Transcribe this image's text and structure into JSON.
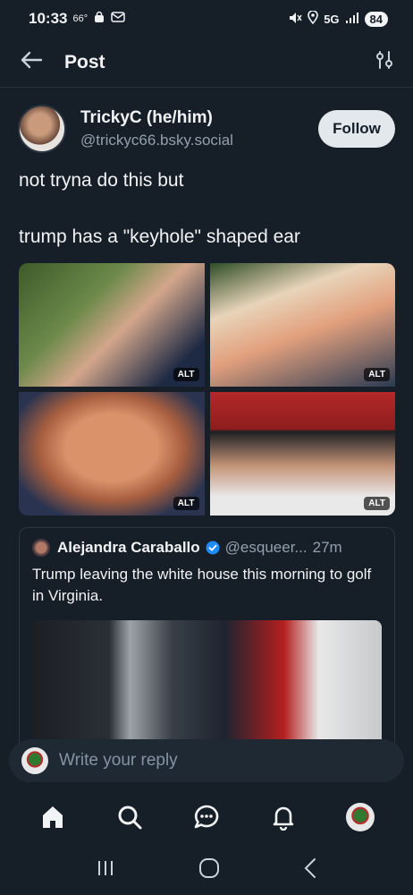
{
  "status_bar": {
    "time": "10:33",
    "temperature": "66°",
    "network": "5G",
    "battery": "84"
  },
  "header": {
    "title": "Post",
    "back_icon": "arrow-left-icon",
    "settings_icon": "sliders-icon"
  },
  "post": {
    "display_name": "TrickyC (he/him)",
    "handle": "@trickyc66.bsky.social",
    "follow_label": "Follow",
    "text_line1": "not tryna do this but",
    "text_line2": "trump has a \"keyhole\" shaped ear",
    "images": [
      {
        "alt_badge": "ALT"
      },
      {
        "alt_badge": "ALT"
      },
      {
        "alt_badge": "ALT"
      },
      {
        "alt_badge": "ALT"
      }
    ]
  },
  "quote": {
    "author_name": "Alejandra Caraballo",
    "handle": "@esqueer...",
    "time": "27m",
    "text": "Trump leaving the white house this morning to golf in Virginia."
  },
  "reply": {
    "placeholder": "Write your reply"
  },
  "tabbar": {
    "items": [
      "home-icon",
      "search-icon",
      "chat-icon",
      "bell-icon",
      "profile-avatar"
    ]
  },
  "colors": {
    "background": "#161e27",
    "accent": "#208bfe",
    "muted_text": "#93a0ad"
  }
}
